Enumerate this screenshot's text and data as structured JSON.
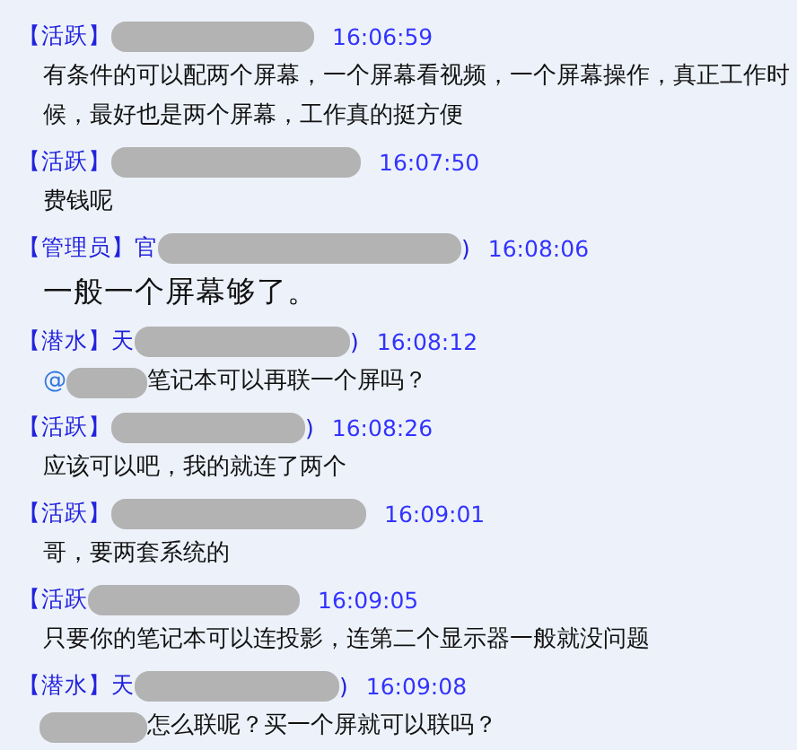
{
  "messages": [
    {
      "badge": "【活跃】",
      "time": "16:06:59",
      "lines": [
        "有条件的可以配两个屏幕，一个屏幕看视频，一个屏幕操作，真正工作时",
        "候，最好也是两个屏幕，工作真的挺方便"
      ],
      "large": false
    },
    {
      "badge": "【活跃】",
      "time": "16:07:50",
      "lines": [
        "费钱呢"
      ],
      "large": false
    },
    {
      "badge": "【管理员】",
      "name_prefix": "官",
      "name_suffix": ")",
      "time": "16:08:06",
      "lines": [
        "一般一个屏幕够了。"
      ],
      "large": true
    },
    {
      "badge": "【潜水】",
      "name_prefix": "天",
      "name_suffix": ")",
      "time": "16:08:12",
      "lead": {
        "kind": "mention",
        "text": "@"
      },
      "lines": [
        "笔记本可以再联一个屏吗？"
      ],
      "large": false
    },
    {
      "badge": "【活跃】",
      "name_suffix": ")",
      "time": "16:08:26",
      "lines": [
        "应该可以吧，我的就连了两个"
      ],
      "large": false
    },
    {
      "badge": "【活跃】",
      "time": "16:09:01",
      "lines": [
        "哥，要两套系统的"
      ],
      "large": false
    },
    {
      "badge": "【活跃",
      "time": "16:09:05",
      "lines": [
        "只要你的笔记本可以连投影，连第二个显示器一般就没问题"
      ],
      "large": false
    },
    {
      "badge": "【潜水】",
      "name_prefix": "天",
      "name_suffix": ")",
      "time": "16:09:08",
      "lead": {
        "kind": "redacted"
      },
      "lines": [
        "怎么联呢？买一个屏就可以联吗？"
      ],
      "large": false
    }
  ]
}
